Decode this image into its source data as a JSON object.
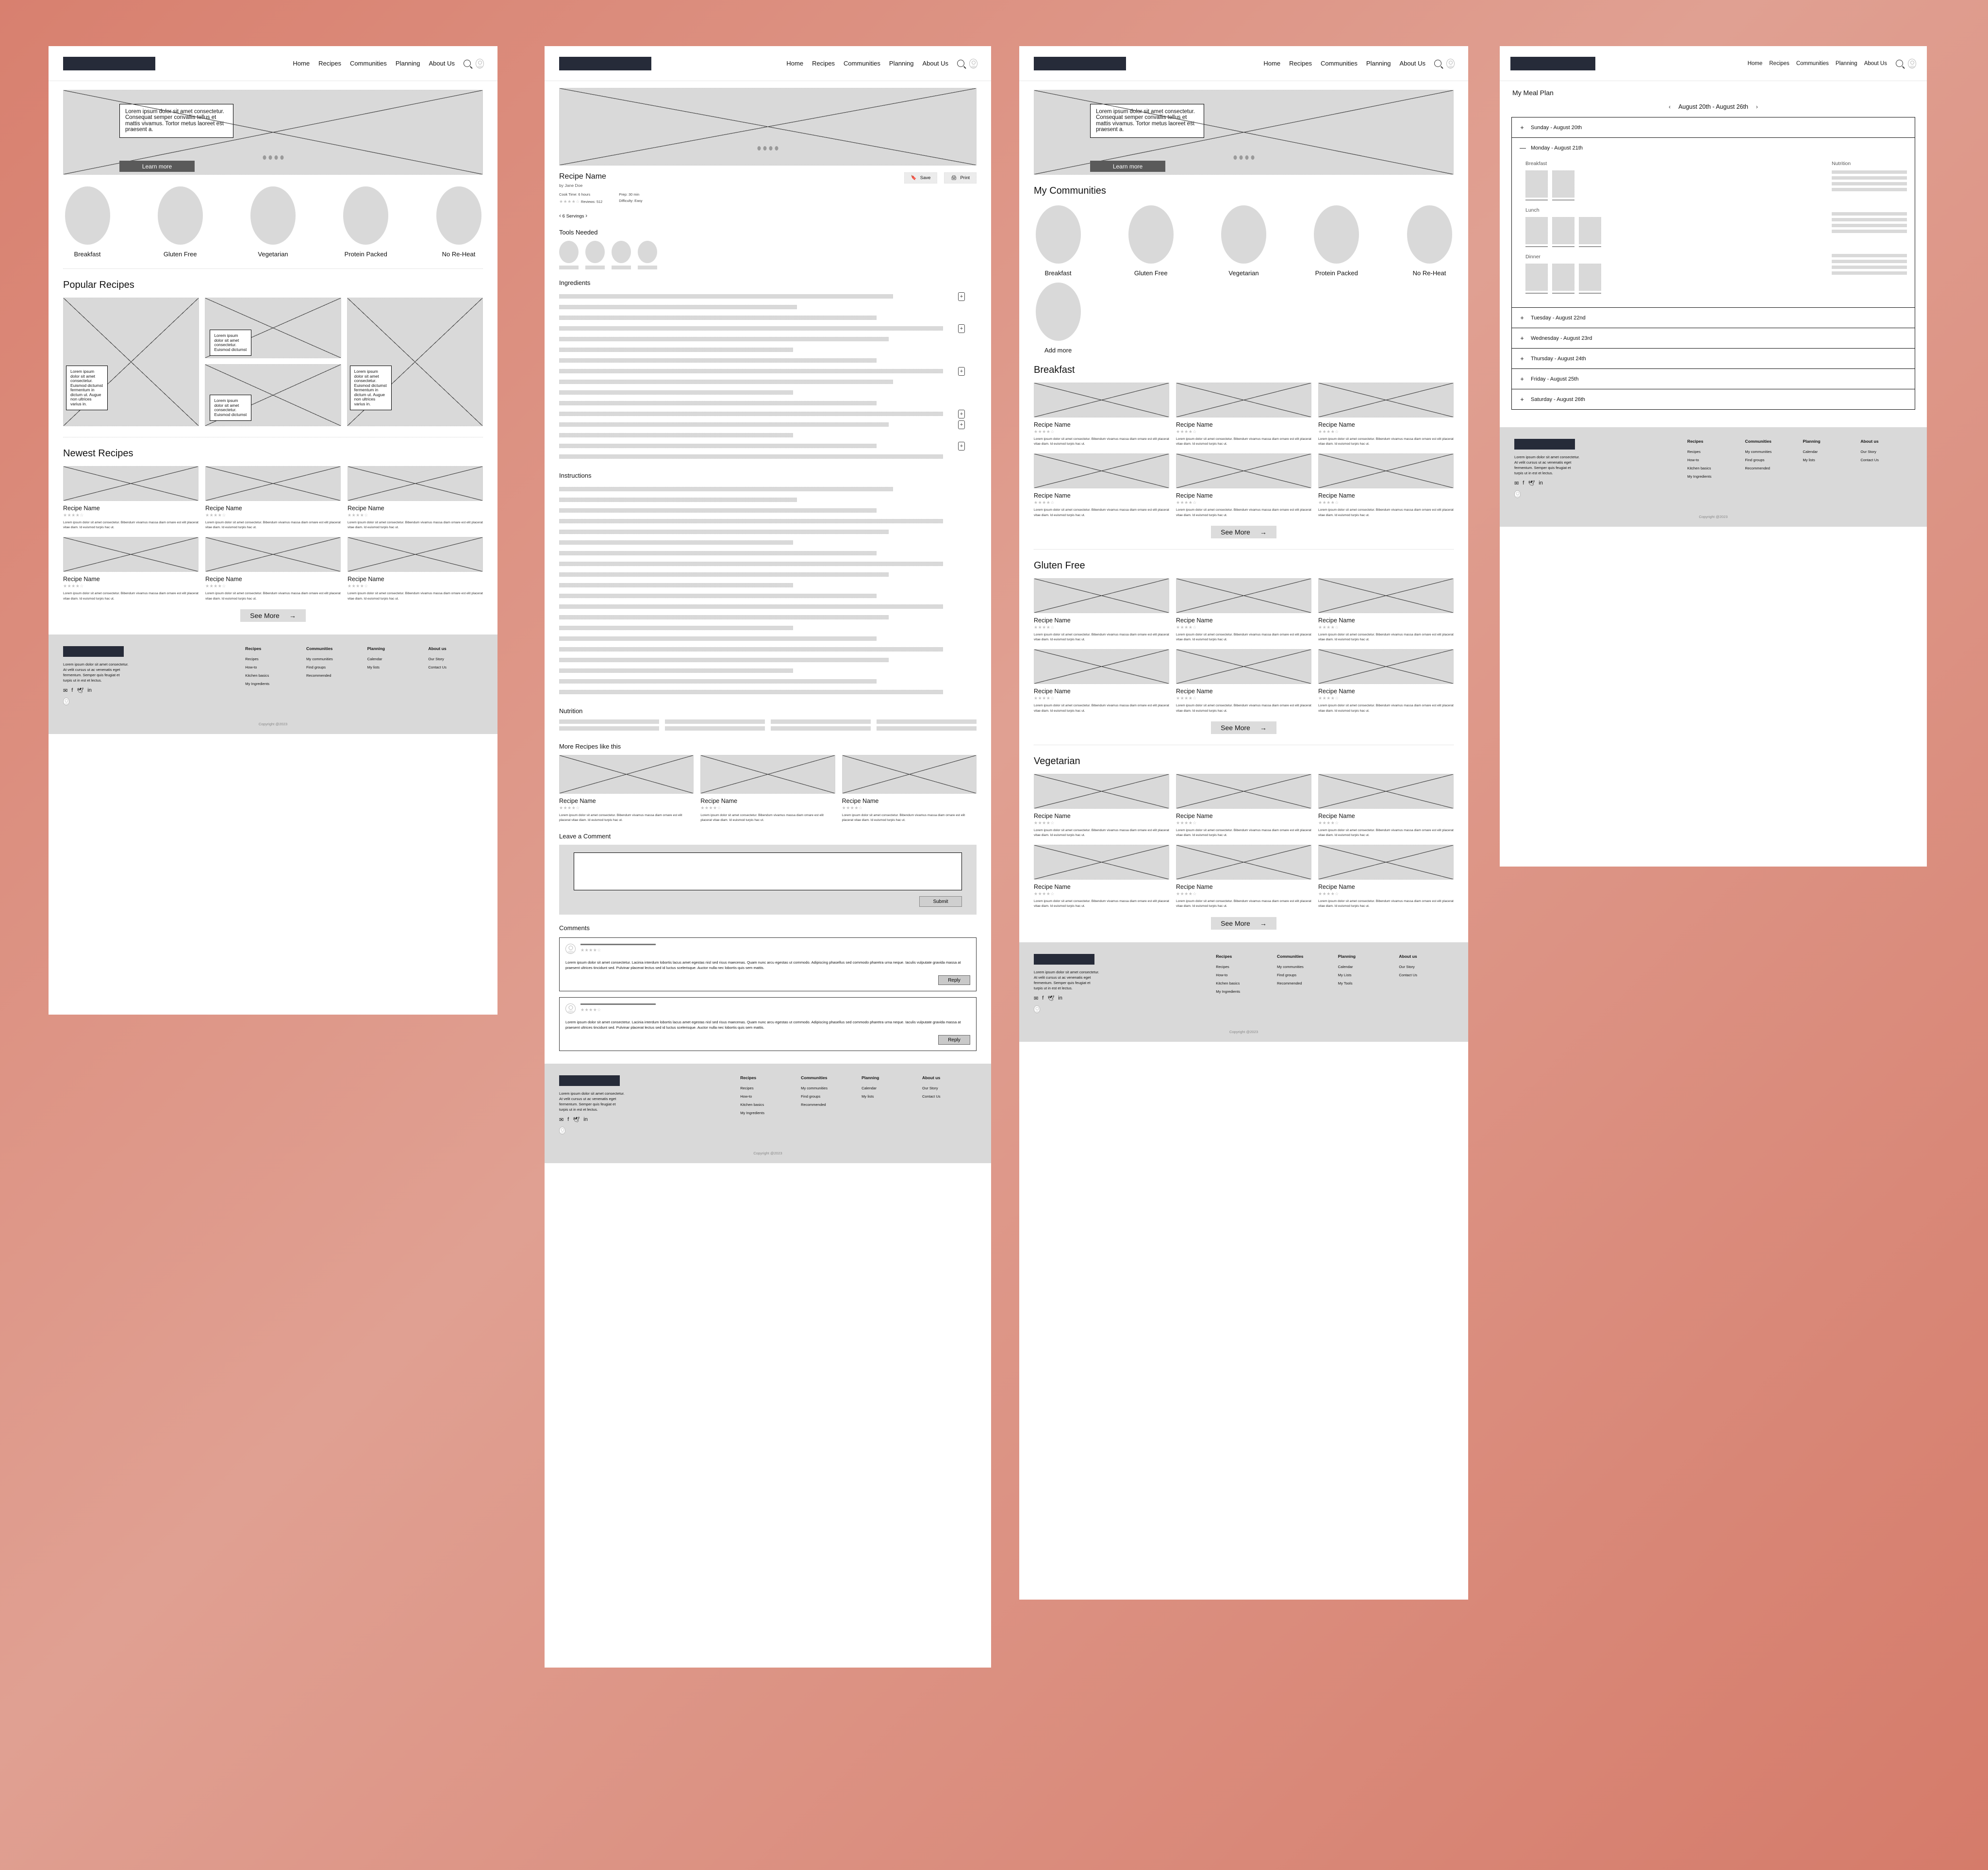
{
  "brand": {
    "accent_background": "#d98070",
    "logo_color": "#262b39",
    "placeholder_gray": "#d9d9d9"
  },
  "nav": {
    "links": [
      "Home",
      "Recipes",
      "Communities",
      "Planning",
      "About Us"
    ],
    "icons": [
      "search-icon",
      "avatar-icon"
    ]
  },
  "hero": {
    "text": "Lorem ipsum dolor sit amet consectetur. Consequat semper convallis tellus et mattis vivamus. Tortor metus laoreet est praesent a.",
    "button": "Learn more",
    "dots": 4
  },
  "categories": [
    {
      "label": "Breakfast"
    },
    {
      "label": "Gluten Free"
    },
    {
      "label": "Vegetarian"
    },
    {
      "label": "Protein Packed"
    },
    {
      "label": "No Re-Heat"
    }
  ],
  "home": {
    "popular_title": "Popular Recipes",
    "newest_title": "Newest Recipes",
    "callout_short": "Lorem ipsum dolor sit amet consectetur. Euismod dictumst",
    "callout_long": "Lorem ipsum dolor sit amet consectetur. Euismod dictumst fermentum in dictum ut. Augue non ultrices varius in.",
    "see_more": "See More",
    "arrow": "→",
    "recipe_card": {
      "name": "Recipe Name",
      "stars_filled": 4,
      "stars_total": 5,
      "desc": "Lorem ipsum dolor sit amet consectetur. Bibendum vivamus massa diam ornare est elit placerat vitae diam. Id euismod turpis hac ut."
    }
  },
  "footer": {
    "description": "Lorem ipsum dolor sit amet consectetur. At velit cursus ut ac venenatis eget fermentum. Semper quis feugiat et turpis ut in est et lectus.",
    "social": [
      "mail-icon",
      "facebook-icon",
      "twitter-icon",
      "linkedin-icon"
    ],
    "columns": [
      {
        "heading": "Recipes",
        "items": [
          "Recipes",
          "How-to",
          "Kitchen basics",
          "My Ingredients"
        ]
      },
      {
        "heading": "Communities",
        "items": [
          "My communities",
          "Find groups",
          "Recommended"
        ]
      },
      {
        "heading": "Planning",
        "items": [
          "Calendar",
          "My lists"
        ]
      },
      {
        "heading": "About us",
        "items": [
          "Our Story",
          "Contact Us"
        ]
      }
    ],
    "columns_browse": [
      {
        "heading": "Recipes",
        "items": [
          "Recipes",
          "How-to",
          "Kitchen basics",
          "My Ingredients"
        ]
      },
      {
        "heading": "Communities",
        "items": [
          "My communities",
          "Find groups",
          "Recommended"
        ]
      },
      {
        "heading": "Planning",
        "items": [
          "Calendar",
          "My Lists",
          "My Tools"
        ]
      },
      {
        "heading": "About us",
        "items": [
          "Our Story",
          "Contact Us"
        ]
      }
    ],
    "copyright": "Copyright @2023"
  },
  "recipe": {
    "title": "Recipe Name",
    "author": "by Jane Doe",
    "cook_time": "Cook Time: 6 hours",
    "reviews": "Reviews: 512",
    "prep": "Prep: 30 min",
    "difficulty": "Difficulty: Easy",
    "save_label": "Save",
    "print_label": "Print",
    "servings": "6 Servings",
    "servings_prev": "‹",
    "servings_next": "›",
    "tools_title": "Tools Needed",
    "ingredients_title": "Ingredients",
    "instructions_title": "Instructions",
    "nutrition_title": "Nutrition",
    "more_recipes_title": "More Recipes like this",
    "leave_comment_title": "Leave a Comment",
    "submit_label": "Submit",
    "comments_title": "Comments",
    "reply_label": "Reply",
    "comment_body": "Lorem ipsum dolor sit amet consectetur. Lacinia interdum lobortis lacus amet egestas nisl sed risus maecenas. Quam nunc arcu egestas ut commodo. Adipiscing phasellus sed commodo pharetra urna neque. Iaculis vulputate gravida massa at praesent ultrices tincidunt sed. Pulvinar placerat lectus sed id luctus scelerisque. Auctor nulla nec lobortis quis sem mattis.",
    "add_icon": "+",
    "ingredient_widths": [
      80,
      57,
      76,
      92,
      79,
      56,
      76,
      92,
      80,
      56,
      76,
      92,
      79,
      56,
      76,
      92
    ],
    "ingredient_plus_rows": [
      0,
      3,
      7,
      11,
      12,
      14
    ],
    "instruction_widths": [
      80,
      57,
      76,
      92,
      79,
      56,
      76,
      92,
      79,
      56,
      76,
      92,
      79,
      56,
      76,
      92,
      79,
      56,
      76,
      92
    ]
  },
  "browse": {
    "communities_title": "My Communities",
    "add_more": "Add more",
    "sections": [
      "Breakfast",
      "Gluten Free",
      "Vegetarian"
    ],
    "see_more": "See More",
    "arrow": "→"
  },
  "plan": {
    "page_title": "My Meal Plan",
    "week_range": "August 20th - August 26th",
    "prev": "‹",
    "next": "›",
    "expand": "+",
    "collapse": "—",
    "nutrition_label": "Nutrition",
    "days": [
      {
        "label": "Sunday - August 20th",
        "expanded": false
      },
      {
        "label": "Monday - August 21th",
        "expanded": true
      },
      {
        "label": "Tuesday - August 22nd",
        "expanded": false
      },
      {
        "label": "Wednesday - August 23rd",
        "expanded": false
      },
      {
        "label": "Thursday - August 24th",
        "expanded": false
      },
      {
        "label": "Friday - August 25th",
        "expanded": false
      },
      {
        "label": "Saturday - August 26th",
        "expanded": false
      }
    ],
    "meals": [
      {
        "label": "Breakfast",
        "count": 2
      },
      {
        "label": "Lunch",
        "count": 3
      },
      {
        "label": "Dinner",
        "count": 3
      }
    ]
  }
}
